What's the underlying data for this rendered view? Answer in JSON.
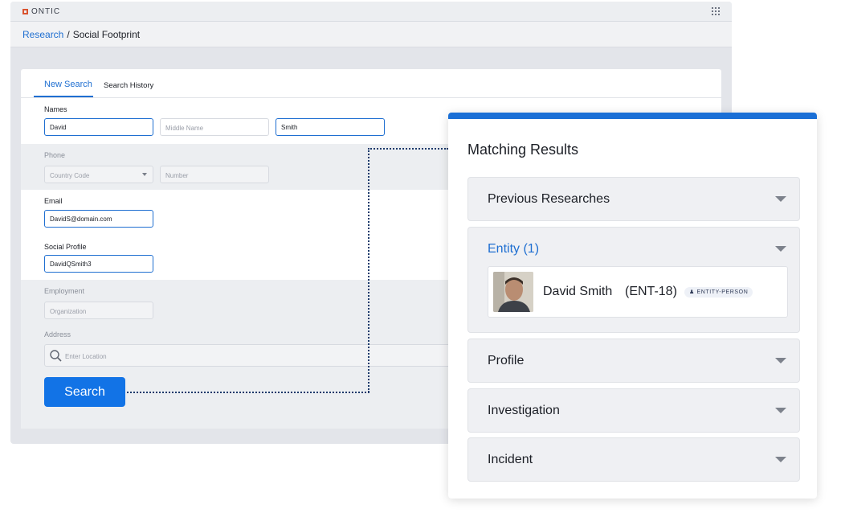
{
  "app": {
    "logo_text": "ONTIC"
  },
  "breadcrumb": {
    "parent": "Research",
    "separator": "/",
    "current": "Social Footprint"
  },
  "tabs": {
    "new_search": "New Search",
    "search_history": "Search History"
  },
  "form": {
    "names_label": "Names",
    "first_name": "David",
    "middle_name_placeholder": "Middle Name",
    "last_name": "Smith",
    "phone_label": "Phone",
    "country_code_placeholder": "Country Code",
    "number_placeholder": "Number",
    "email_label": "Email",
    "email_value": "DavidS@domain.com",
    "social_label": "Social Profile",
    "social_value": "DavidQSmith3",
    "employment_label": "Employment",
    "organization_placeholder": "Organization",
    "address_label": "Address",
    "location_placeholder": "Enter Location",
    "search_button": "Search"
  },
  "results": {
    "title": "Matching Results",
    "sections": {
      "previous": "Previous Researches",
      "entity": "Entity (1)",
      "profile": "Profile",
      "investigation": "Investigation",
      "incident": "Incident"
    },
    "entity_item": {
      "name": "David Smith",
      "id": "(ENT-18)",
      "badge": "ENTITY-PERSON"
    }
  },
  "colors": {
    "accent": "#1f6fd1",
    "button": "#1273e6",
    "panel_top": "#1a6fd6",
    "logo_mark": "#d9532f"
  }
}
